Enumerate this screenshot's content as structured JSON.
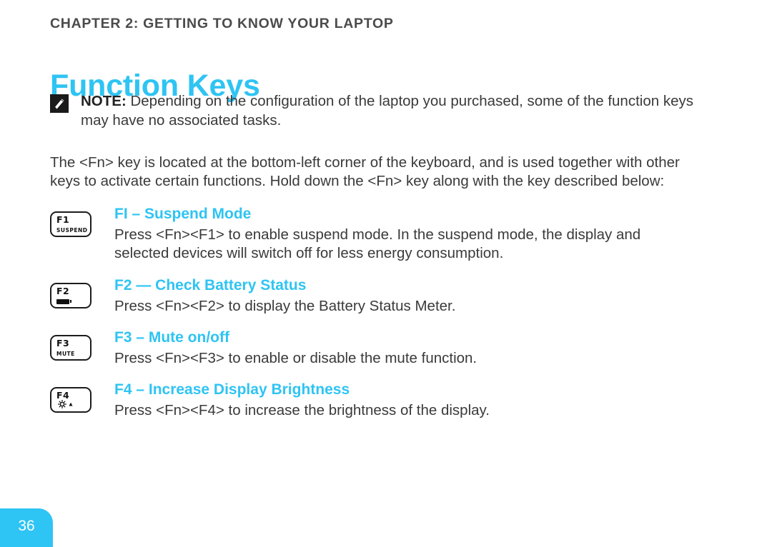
{
  "document": {
    "chapter_header": "CHAPTER 2: GETTING TO KNOW YOUR LAPTOP",
    "title": "Function Keys",
    "page_number": "36",
    "accent_color": "#2ec4f3",
    "text_color": "#3a3a3a",
    "background_color": "#ffffff"
  },
  "note": {
    "icon": "note-pencil-icon",
    "label": "NOTE:",
    "text": " Depending on the configuration of the laptop you purchased, some of the function keys may have no associated tasks."
  },
  "intro": {
    "paragraph": "The <Fn> key is located at the bottom-left corner of the keyboard, and is used together with other keys to activate certain functions. Hold down the <Fn> key along with the key described below:"
  },
  "function_keys": [
    {
      "key_label": "F1",
      "key_sub": "SUSPEND",
      "key_glyph": "text",
      "icon_name": "keycap-f1-suspend-icon",
      "heading": "FI – Suspend Mode",
      "description": "Press <Fn><F1> to enable suspend mode. In the suspend mode, the display and selected devices will switch off for less energy consumption."
    },
    {
      "key_label": "F2",
      "key_sub": "",
      "key_glyph": "battery",
      "icon_name": "keycap-f2-battery-icon",
      "heading": "F2 — Check Battery Status",
      "description": "Press <Fn><F2> to display the Battery Status Meter."
    },
    {
      "key_label": "F3",
      "key_sub": "MUTE",
      "key_glyph": "text",
      "icon_name": "keycap-f3-mute-icon",
      "heading": "F3 – Mute on/off",
      "description": "Press <Fn><F3> to enable or disable the mute function."
    },
    {
      "key_label": "F4",
      "key_sub": "",
      "key_glyph": "brightness",
      "icon_name": "keycap-f4-brightness-icon",
      "heading": "F4 – Increase Display Brightness",
      "description": "Press <Fn><F4> to increase the brightness of the display."
    }
  ]
}
